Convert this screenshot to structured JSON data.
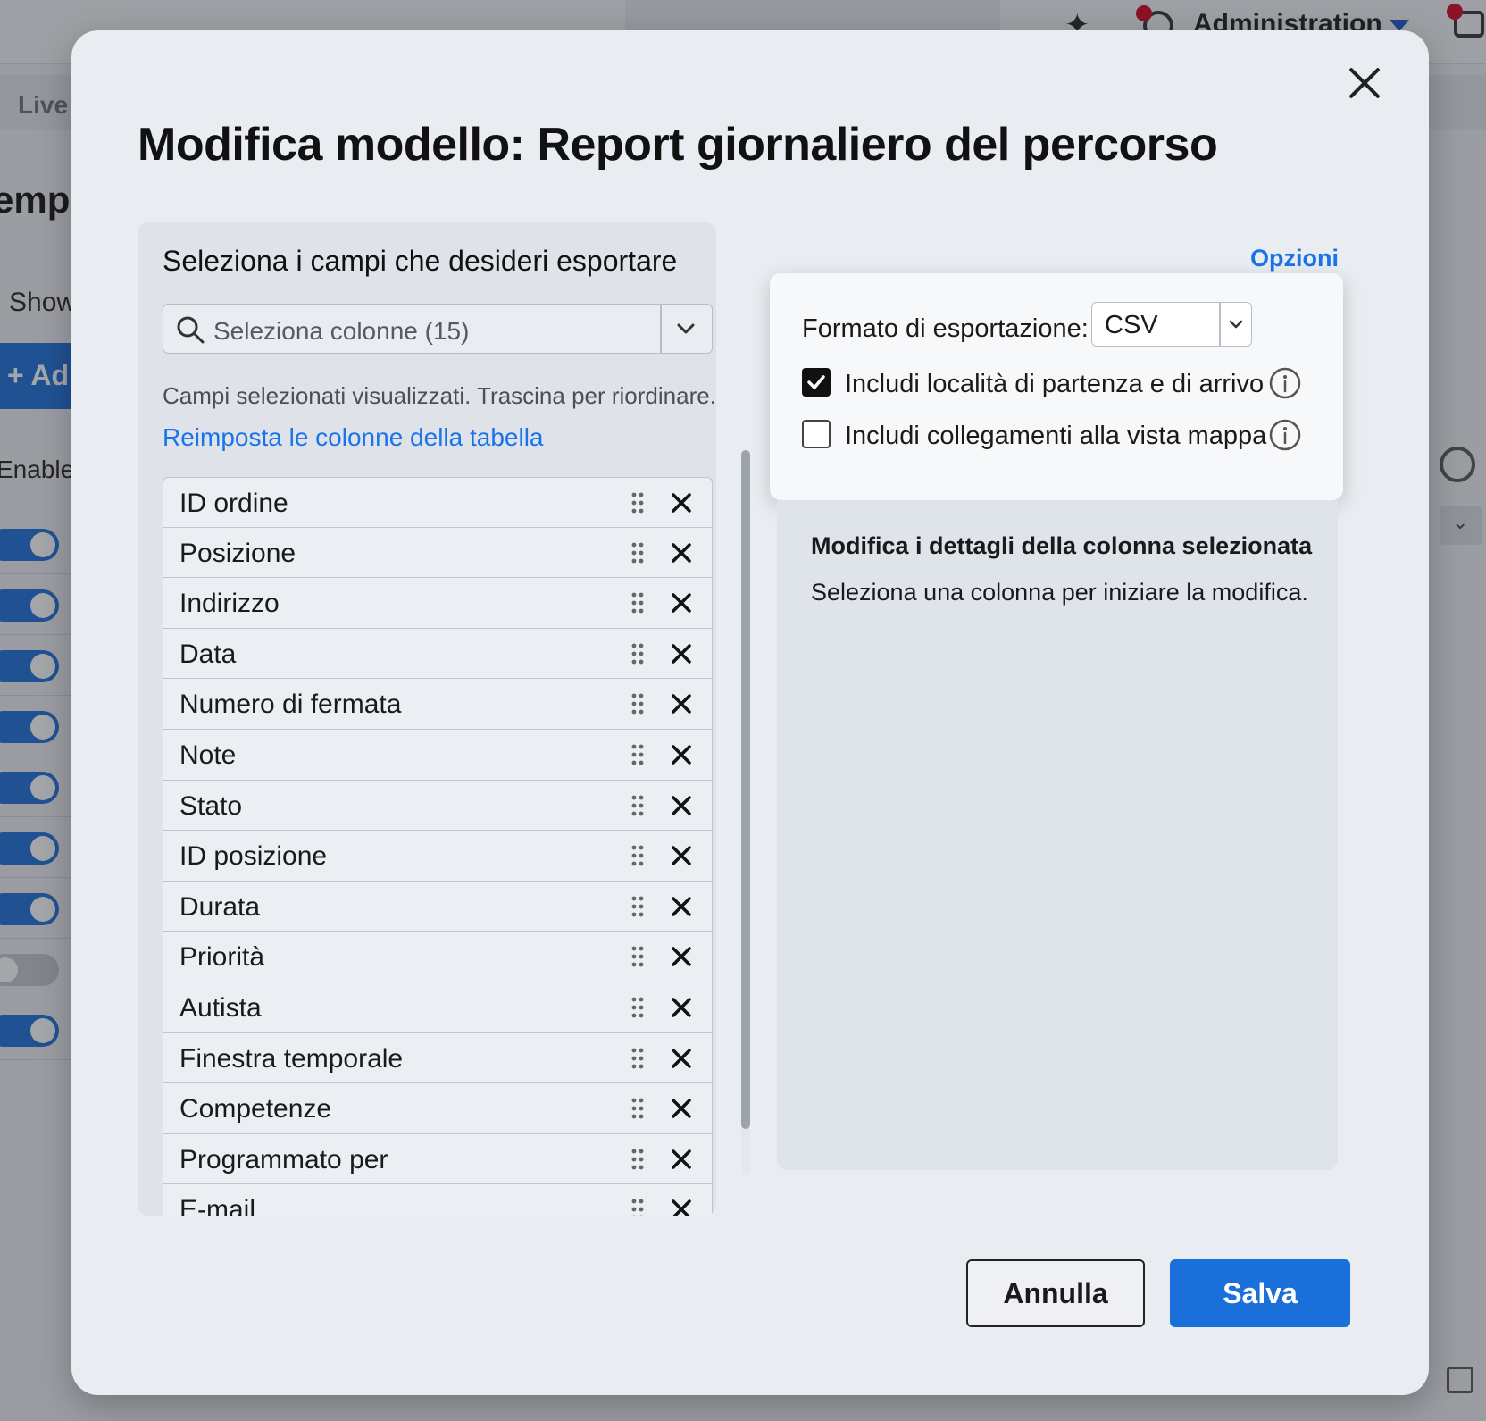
{
  "background": {
    "header_admin": "Administration",
    "tab_live": "Live",
    "page_title_fragment": "empla",
    "show_label": "Show",
    "add_button": "+ Ad",
    "enabled_header": "Enable",
    "toggles": [
      true,
      true,
      true,
      true,
      true,
      true,
      true,
      false,
      true
    ]
  },
  "modal": {
    "title": "Modifica modello: Report giornaliero del percorso",
    "close_icon": "close-icon",
    "left_panel": {
      "heading": "Seleziona i campi che desideri esportare",
      "column_select_placeholder": "Seleziona colonne (15)",
      "hint": "Campi selezionati visualizzati. Trascina per riordinare.",
      "reset_link": "Reimposta le colonne della tabella",
      "fields": [
        "ID ordine",
        "Posizione",
        "Indirizzo",
        "Data",
        "Numero di fermata",
        "Note",
        "Stato",
        "ID posizione",
        "Durata",
        "Priorità",
        "Autista",
        "Finestra temporale",
        "Competenze",
        "Programmato per",
        "E-mail"
      ]
    },
    "options": {
      "link": "Opzioni",
      "format_label": "Formato di esportazione:",
      "format_value": "CSV",
      "include_start_end": {
        "label": "Includi località di partenza e di arrivo",
        "checked": true
      },
      "include_map_links": {
        "label": "Includi collegamenti alla vista mappa",
        "checked": false
      }
    },
    "details": {
      "title": "Modifica i dettagli della colonna selezionata",
      "text": "Seleziona una colonna per iniziare la modifica."
    },
    "buttons": {
      "cancel": "Annulla",
      "save": "Salva"
    }
  },
  "colors": {
    "accent": "#1a73e8",
    "primary_button": "#1a6fd8",
    "notification_dot": "#d0021b"
  }
}
